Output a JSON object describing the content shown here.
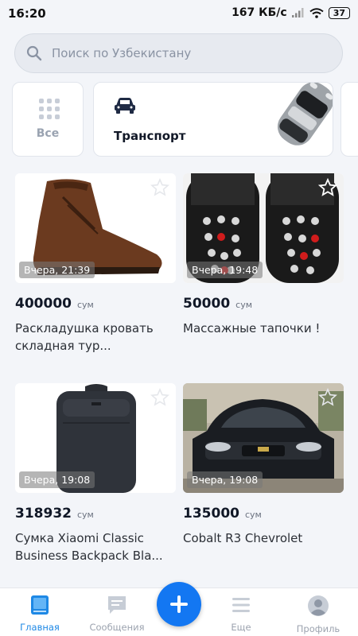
{
  "status_bar": {
    "time": "16:20",
    "network_speed": "167 КБ/с",
    "battery": "37"
  },
  "search": {
    "placeholder": "Поиск по Узбекистану",
    "icon": "search-icon"
  },
  "categories": {
    "all_label": "Все",
    "transport_label": "Транспорт"
  },
  "listings": [
    {
      "time": "Вчера, 21:39",
      "price": "400000",
      "currency": "сум",
      "title": "Раскладушка кровать складная тур..."
    },
    {
      "time": "Вчера, 19:48",
      "price": "50000",
      "currency": "сум",
      "title": "Массажные тапочки !"
    },
    {
      "time": "Вчера, 19:08",
      "price": "318932",
      "currency": "сум",
      "title": "Сумка Xiaomi Classic Business Backpack Bla..."
    },
    {
      "time": "Вчера, 19:08",
      "price": "135000",
      "currency": "сум",
      "title": "Cobalt R3 Chevrolet"
    }
  ],
  "bottom_nav": {
    "home": "Главная",
    "messages": "Сообщения",
    "more": "Еще",
    "profile": "Профиль"
  },
  "colors": {
    "accent": "#1377f2",
    "active_tab": "#1e88e5",
    "background": "#f3f5f9"
  }
}
